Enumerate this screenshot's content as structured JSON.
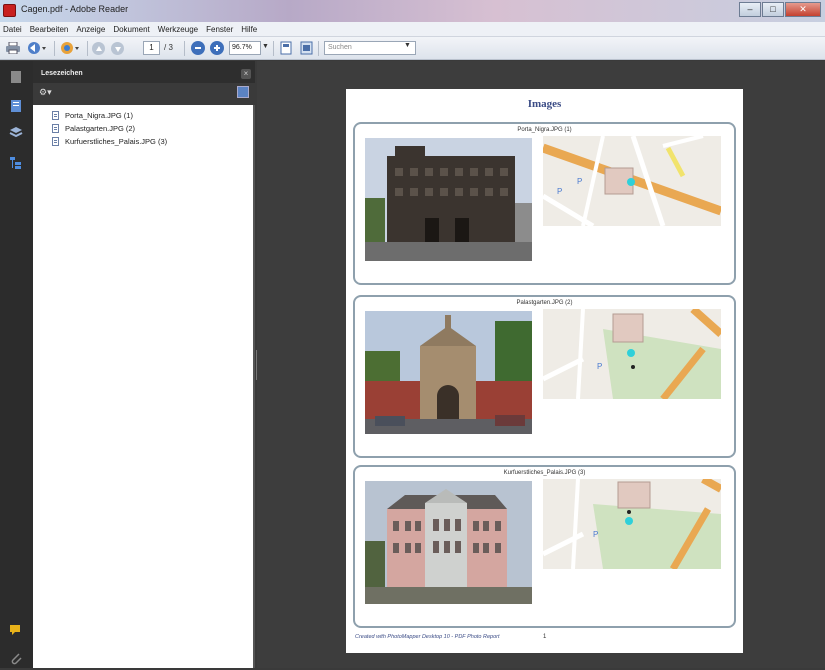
{
  "window": {
    "title": "Cagen.pdf - Adobe Reader",
    "controls": [
      "–",
      "□",
      "✕"
    ]
  },
  "menu": [
    "Datei",
    "Bearbeiten",
    "Anzeige",
    "Dokument",
    "Werkzeuge",
    "Fenster",
    "Hilfe"
  ],
  "toolbar": {
    "page_current": "1",
    "page_total": "/ 3",
    "zoom": "96.7%",
    "search_placeholder": "Suchen"
  },
  "bookmarks_panel": {
    "title": "Lesezeichen",
    "items": [
      {
        "label": "Porta_Nigra.JPG (1)"
      },
      {
        "label": "Palastgarten.JPG (2)"
      },
      {
        "label": "Kurfuerstliches_Palais.JPG (3)"
      }
    ]
  },
  "document": {
    "heading": "Images",
    "cards": [
      {
        "title": "Porta_Nigra.JPG (1)"
      },
      {
        "title": "Palastgarten.JPG (2)"
      },
      {
        "title": "Kurfuerstliches_Palais.JPG (3)"
      }
    ],
    "footer": "Created with PhotoMapper Desktop 10 - PDF Photo Report",
    "page_number": "1"
  },
  "colors": {
    "accent": "#3b4c86",
    "panel_dark": "#2e2e2e",
    "doc_bg": "#3d3d3d"
  }
}
